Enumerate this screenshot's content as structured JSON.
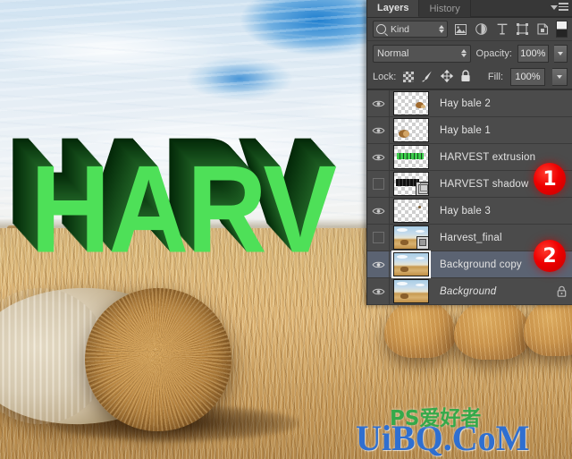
{
  "app": {
    "photo_alt": "harvested-field-with-round-hay-bales",
    "overlay_text": "HARV"
  },
  "panel": {
    "tabs": [
      {
        "label": "Layers",
        "active": true
      },
      {
        "label": "History",
        "active": false
      }
    ],
    "menu_icon": "panel-menu-icon",
    "filter": {
      "search_icon": "search-icon",
      "kind_label": "Kind",
      "stepper_icon": "stepper-icon",
      "icons": [
        "pixel-layer-filter-icon",
        "adjustment-layer-filter-icon",
        "type-layer-filter-icon",
        "shape-layer-filter-icon",
        "smart-object-filter-icon"
      ],
      "toggle_icon": "filter-toggle-switch"
    },
    "blend": {
      "mode": "Normal",
      "opacity_label": "Opacity:",
      "opacity_value": "100%"
    },
    "lock": {
      "label": "Lock:",
      "icons": [
        "lock-transparent-pixels-icon",
        "lock-image-pixels-icon",
        "lock-position-icon",
        "lock-all-icon"
      ],
      "fill_label": "Fill:",
      "fill_value": "100%"
    },
    "layers": [
      {
        "name": "Hay bale  2",
        "visible": true,
        "selected": false,
        "locked": false,
        "italic": false,
        "thumb": "transparent-haybale-small-right",
        "badge": ""
      },
      {
        "name": "Hay bale  1",
        "visible": true,
        "selected": false,
        "locked": false,
        "italic": false,
        "thumb": "transparent-haybale-small-left",
        "badge": ""
      },
      {
        "name": "HARVEST extrusion",
        "visible": true,
        "selected": false,
        "locked": false,
        "italic": false,
        "thumb": "transparent-green-text",
        "badge": ""
      },
      {
        "name": "HARVEST shadow",
        "visible": false,
        "selected": false,
        "locked": false,
        "italic": false,
        "thumb": "transparent-dark-text",
        "badge": "3d-cube-badge"
      },
      {
        "name": "Hay bale  3",
        "visible": true,
        "selected": false,
        "locked": false,
        "italic": false,
        "thumb": "transparent-empty",
        "badge": ""
      },
      {
        "name": "Harvest_final",
        "visible": false,
        "selected": false,
        "locked": false,
        "italic": false,
        "thumb": "field-photo",
        "badge": "smart-object-badge"
      },
      {
        "name": "Background copy",
        "visible": true,
        "selected": true,
        "locked": false,
        "italic": false,
        "thumb": "field-photo",
        "badge": ""
      },
      {
        "name": "Background",
        "visible": true,
        "selected": false,
        "locked": true,
        "italic": true,
        "thumb": "field-photo",
        "badge": ""
      }
    ]
  },
  "annotations": [
    {
      "id": "1",
      "label": "1",
      "target_layer": "HARVEST shadow"
    },
    {
      "id": "2",
      "label": "2",
      "target_layer": "Background copy"
    }
  ],
  "watermark": {
    "main": "UiBQ.CoM",
    "sub": "PS爱好者"
  },
  "colors": {
    "panel_bg": "#454545",
    "row_bg": "#4b4b4b",
    "row_selected": "#5b6372",
    "text": "#e2e2e2",
    "badge_red": "#ee0000",
    "harvest_green": "#4ee058",
    "harvest_extrusion": "#0b3810",
    "watermark_blue": "#2f6fd0",
    "watermark_green": "#35a94a"
  }
}
